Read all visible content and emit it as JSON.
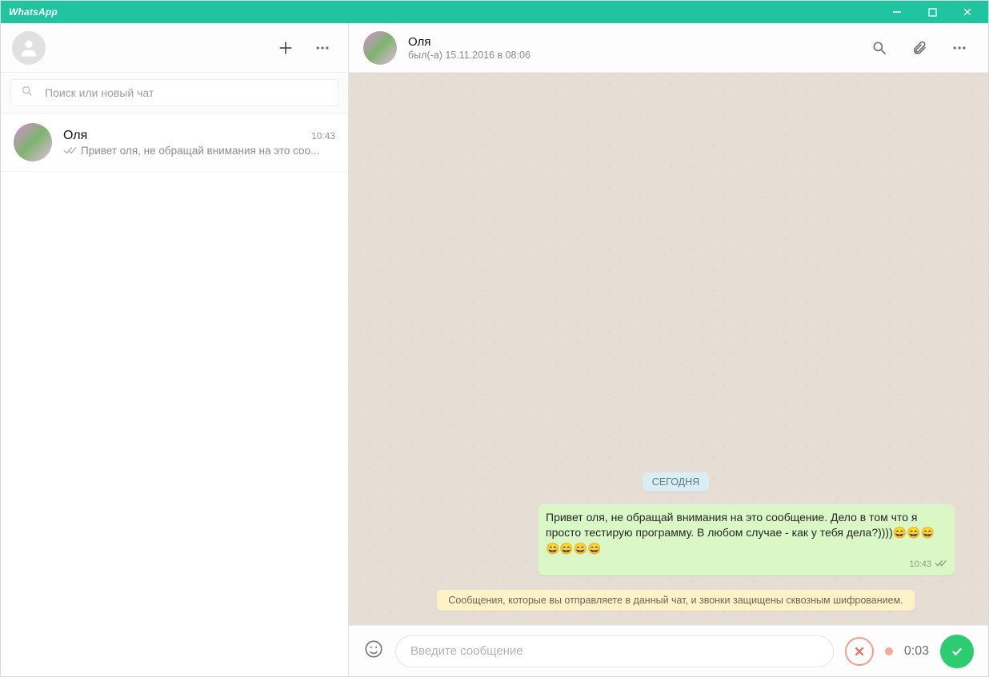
{
  "window": {
    "title": "WhatsApp"
  },
  "sidebar": {
    "search_placeholder": "Поиск или новый чат",
    "chats": [
      {
        "name": "Оля",
        "time": "10:43",
        "preview": "Привет оля, не обращай внимания на это соо..."
      }
    ]
  },
  "chat": {
    "contact_name": "Оля",
    "contact_status": "был(-а) 15.11.2016 в 08:06",
    "date_label": "СЕГОДНЯ",
    "messages": [
      {
        "direction": "out",
        "text": "Привет оля, не обращай внимания на это сообщение. Дело в том что я просто тестирую программу. В любом случае - как у тебя дела?))))😄😄😄😄😄😄😄",
        "time": "10:43"
      }
    ],
    "encryption_notice": "Сообщения, которые вы отправляете в данный чат, и звонки защищены сквозным шифрованием."
  },
  "composer": {
    "placeholder": "Введите сообщение",
    "recording_time": "0:03"
  }
}
